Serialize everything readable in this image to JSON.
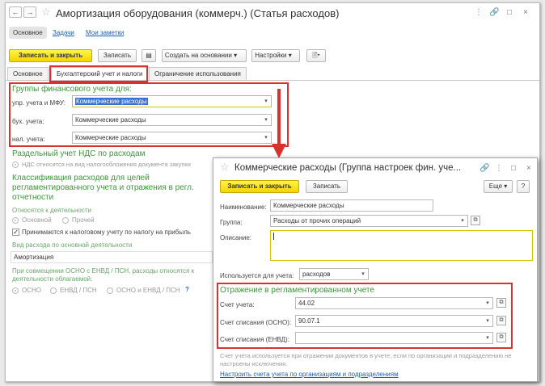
{
  "main": {
    "title": "Амортизация оборудования (коммерч.) (Статья расходов)",
    "nav_back": "←",
    "nav_forward": "→",
    "window_controls": [
      "⋮",
      "🔗",
      "□",
      "×"
    ],
    "tabs": {
      "main": "Основное",
      "tasks": "Задачи",
      "notes": "Мои заметки"
    },
    "toolbar": {
      "save_close": "Записать и закрыть",
      "save": "Записать",
      "create_based": "Создать на основании",
      "settings": "Настройки"
    },
    "form_tabs": [
      "Основное",
      "Бухгалтерский учет и налоги",
      "Ограничение использования"
    ],
    "groups_header": "Группы финансового учета для:",
    "rows": [
      {
        "label": "упр. учета и МФУ:",
        "value": "Коммерческие расходы"
      },
      {
        "label": "бух. учета:",
        "value": "Коммерческие расходы"
      },
      {
        "label": "нал. учета:",
        "value": "Коммерческие расходы"
      }
    ],
    "vat_header": "Раздельный учет НДС по расходам",
    "vat_option": "НДС относится на вид налогообложения документа закупки",
    "class_header": "Классификация расходов для целей регламентированного учета и отражения в регл. отчетности",
    "activity_label": "Относятся к деятельности",
    "activity_options": [
      "Основной",
      "Прочей"
    ],
    "accepted_tax": "Принимаются к налоговому учету по налогу на прибыль",
    "expense_kind_label": "Вид расхода по основной деятельности",
    "expense_kind_value": "Амортизация",
    "osno_question": "При совмещении ОСНО с ЕНВД / ПСН, расходы относятся к деятельности облагаемой:",
    "osno_options": [
      "ОСНО",
      "ЕНВД / ПСН",
      "ОСНО и ЕНВД / ПСН"
    ],
    "help": "?"
  },
  "popup": {
    "title": "Коммерческие расходы (Группа настроек фин. уче...",
    "window_controls": [
      "🔗",
      "⋮",
      "□",
      "×"
    ],
    "save_close": "Записать и закрыть",
    "save": "Записать",
    "more": "Еще",
    "help": "?",
    "name_label": "Наименование:",
    "name_value": "Коммерческие расходы",
    "group_label": "Группа:",
    "group_value": "Расходы от прочих операций",
    "desc_label": "Описание:",
    "desc_value": "",
    "used_for_label": "Используется для учета:",
    "used_for_value": "расходов",
    "reg_header": "Отражение в регламентированном учете",
    "account_label": "Счет учета:",
    "account_value": "44.02",
    "writeoff_osno_label": "Счет списания (ОСНО):",
    "writeoff_osno_value": "90.07.1",
    "writeoff_envd_label": "Счет списания (ЕНВД):",
    "writeoff_envd_value": "",
    "note": "Счет учета используется при отражении документов в учете, если по организации и подразделению не настроены исключения.",
    "link": "Настроить счета учета по организациям и подразделениям"
  },
  "colors": {
    "accent": "#f2d600",
    "highlight": "#d9312e",
    "header_green": "#3a9a3a",
    "link": "#1f5fb3"
  }
}
